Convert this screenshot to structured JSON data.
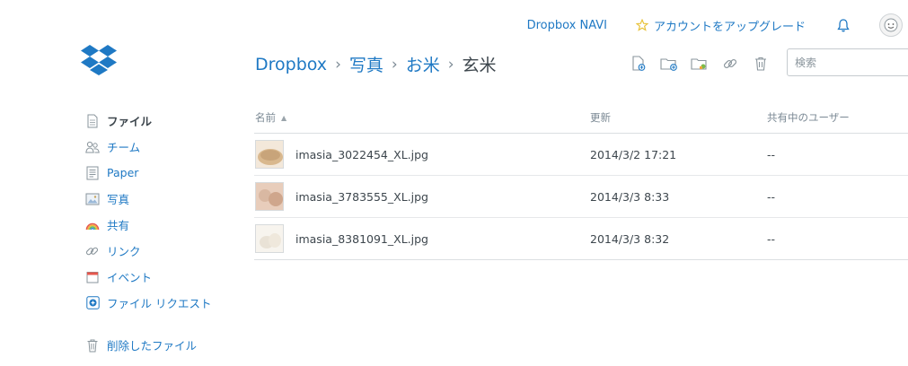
{
  "topbar": {
    "navi_link": "Dropbox NAVI",
    "upgrade_link": "アカウントをアップグレード",
    "star_color": "#e8c23a",
    "icons": [
      "star-icon",
      "bell-icon",
      "avatar"
    ]
  },
  "breadcrumb": {
    "items": [
      "Dropbox",
      "写真",
      "お米"
    ],
    "current": "玄米",
    "separator": "›"
  },
  "toolbar": {
    "icons": [
      "new-file-icon",
      "new-folder-icon",
      "new-shared-folder-icon",
      "link-icon",
      "delete-icon"
    ],
    "search_placeholder": "検索"
  },
  "sidebar": {
    "items": [
      {
        "label": "ファイル",
        "icon": "file-icon",
        "active": true
      },
      {
        "label": "チーム",
        "icon": "team-icon",
        "active": false
      },
      {
        "label": "Paper",
        "icon": "paper-icon",
        "active": false
      },
      {
        "label": "写真",
        "icon": "photo-icon",
        "active": false
      },
      {
        "label": "共有",
        "icon": "rainbow-icon",
        "active": false
      },
      {
        "label": "リンク",
        "icon": "link-icon",
        "active": false
      },
      {
        "label": "イベント",
        "icon": "calendar-icon",
        "active": false
      },
      {
        "label": "ファイル リクエスト",
        "icon": "file-request-icon",
        "active": false
      }
    ],
    "deleted": {
      "label": "削除したファイル",
      "icon": "trash-icon"
    }
  },
  "table": {
    "headers": {
      "name": "名前",
      "modified": "更新",
      "shared": "共有中のユーザー"
    },
    "sort_indicator": "▲",
    "rows": [
      {
        "name": "imasia_3022454_XL.jpg",
        "modified": "2014/3/2 17:21",
        "shared": "--",
        "thumb_color": "#c8a47a"
      },
      {
        "name": "imasia_3783555_XL.jpg",
        "modified": "2014/3/3 8:33",
        "shared": "--",
        "thumb_color": "#d9b8a2"
      },
      {
        "name": "imasia_8381091_XL.jpg",
        "modified": "2014/3/3 8:32",
        "shared": "--",
        "thumb_color": "#e9e2d6"
      }
    ]
  },
  "colors": {
    "accent": "#1f79c4",
    "text": "#3d464d",
    "muted": "#7b8994"
  }
}
